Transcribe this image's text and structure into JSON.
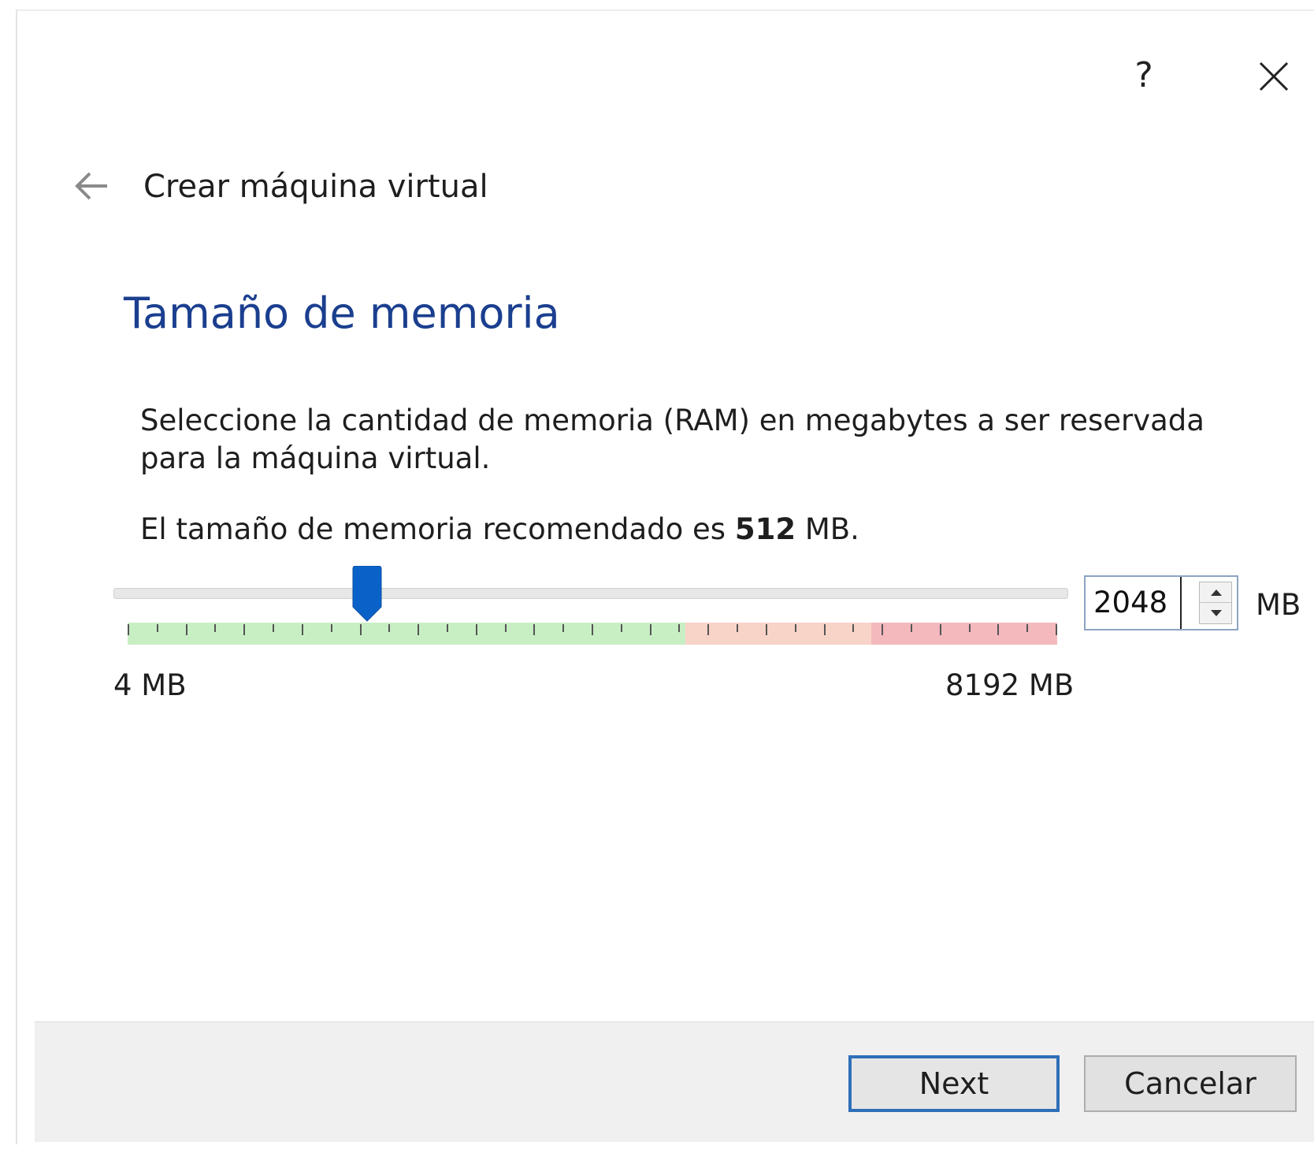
{
  "titlebar": {
    "help_label": "?",
    "help_icon": "help-icon",
    "close_icon": "close-icon"
  },
  "wizard": {
    "title": "Crear máquina virtual",
    "back_icon": "back-arrow-icon"
  },
  "page": {
    "heading": "Tamaño de memoria",
    "description": "Seleccione la cantidad de memoria (RAM) en megabytes a ser reservada para la máquina virtual.",
    "recommended_prefix": "El tamaño de memoria recomendado es",
    "recommended_value": "512",
    "recommended_suffix": "MB."
  },
  "memory": {
    "value": "2048",
    "unit": "MB",
    "min_label": "4 MB",
    "max_label": "8192 MB",
    "min_mb": 4,
    "max_mb": 8192,
    "current_mb": 2048,
    "safe_fraction": 0.6,
    "warning_fraction": 0.2,
    "danger_fraction": 0.2
  },
  "colors": {
    "accent": "#0a62c9",
    "heading": "#1b3f8f",
    "safe": "#c8efc3",
    "warning": "#f8d3c8",
    "danger": "#f4b9bd"
  },
  "footer": {
    "next_label": "Next",
    "cancel_label": "Cancelar"
  }
}
